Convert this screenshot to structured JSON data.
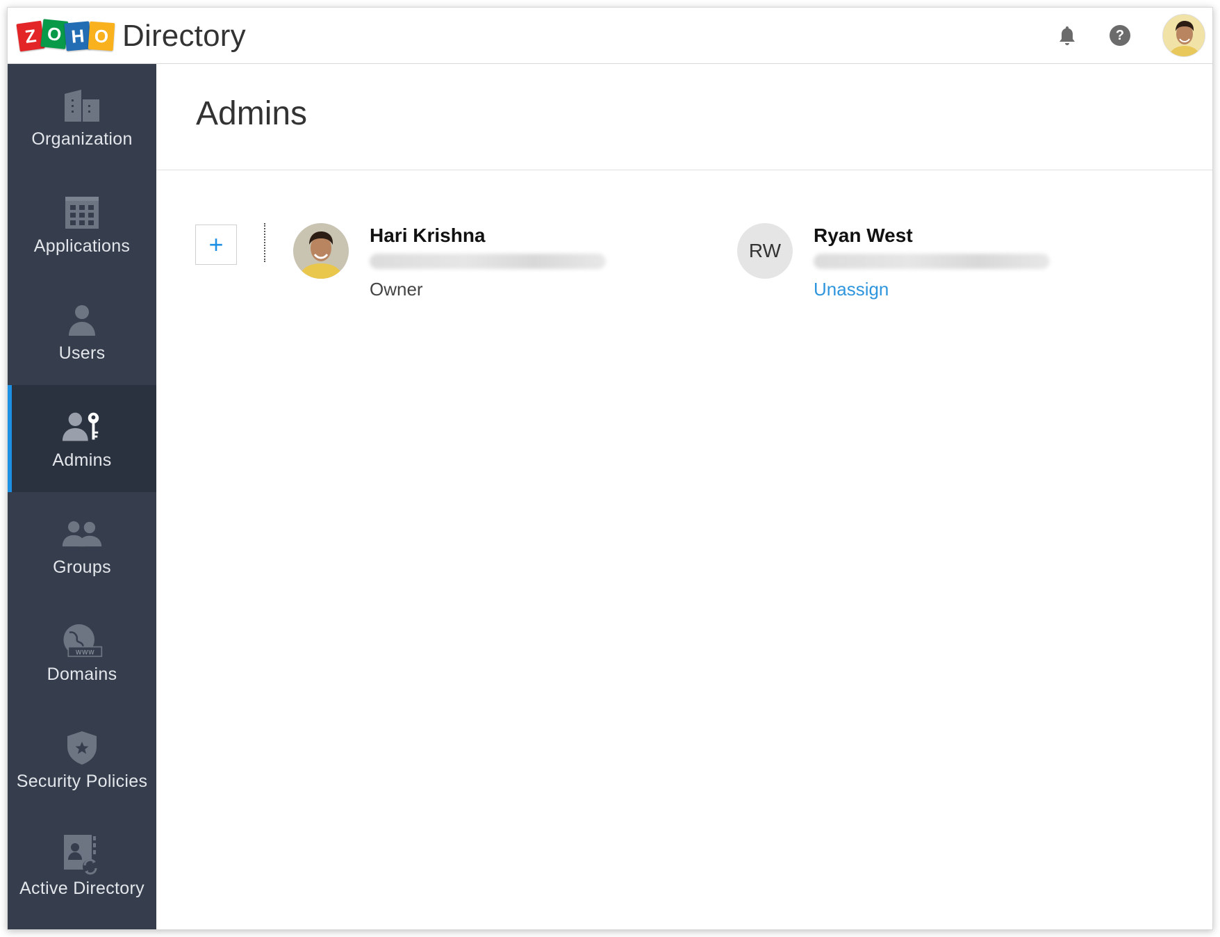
{
  "header": {
    "logo_letters": [
      "Z",
      "O",
      "H",
      "O"
    ],
    "app_title": "Directory",
    "icons": {
      "notifications": "bell-icon",
      "help": "help-icon",
      "avatar": "user-avatar"
    }
  },
  "sidebar": {
    "items": [
      {
        "label": "Organization",
        "icon": "building-icon",
        "active": false
      },
      {
        "label": "Applications",
        "icon": "grid-icon",
        "active": false
      },
      {
        "label": "Users",
        "icon": "user-icon",
        "active": false
      },
      {
        "label": "Admins",
        "icon": "admin-key-icon",
        "active": true
      },
      {
        "label": "Groups",
        "icon": "group-icon",
        "active": false
      },
      {
        "label": "Domains",
        "icon": "globe-www-icon",
        "active": false
      },
      {
        "label": "Security Policies",
        "icon": "shield-star-icon",
        "active": false
      },
      {
        "label": "Active Directory",
        "icon": "ad-sync-icon",
        "active": false
      }
    ]
  },
  "main": {
    "title": "Admins",
    "add_label": "+",
    "admins": [
      {
        "name": "Hari Krishna",
        "avatar": "photo",
        "role": "Owner"
      },
      {
        "name": "Ryan West",
        "initials": "RW",
        "action": "Unassign"
      }
    ]
  },
  "colors": {
    "sidebar_bg": "#363e4d",
    "sidebar_active_bg": "#2b323f",
    "accent": "#1e90e3",
    "link": "#2f96dd"
  }
}
